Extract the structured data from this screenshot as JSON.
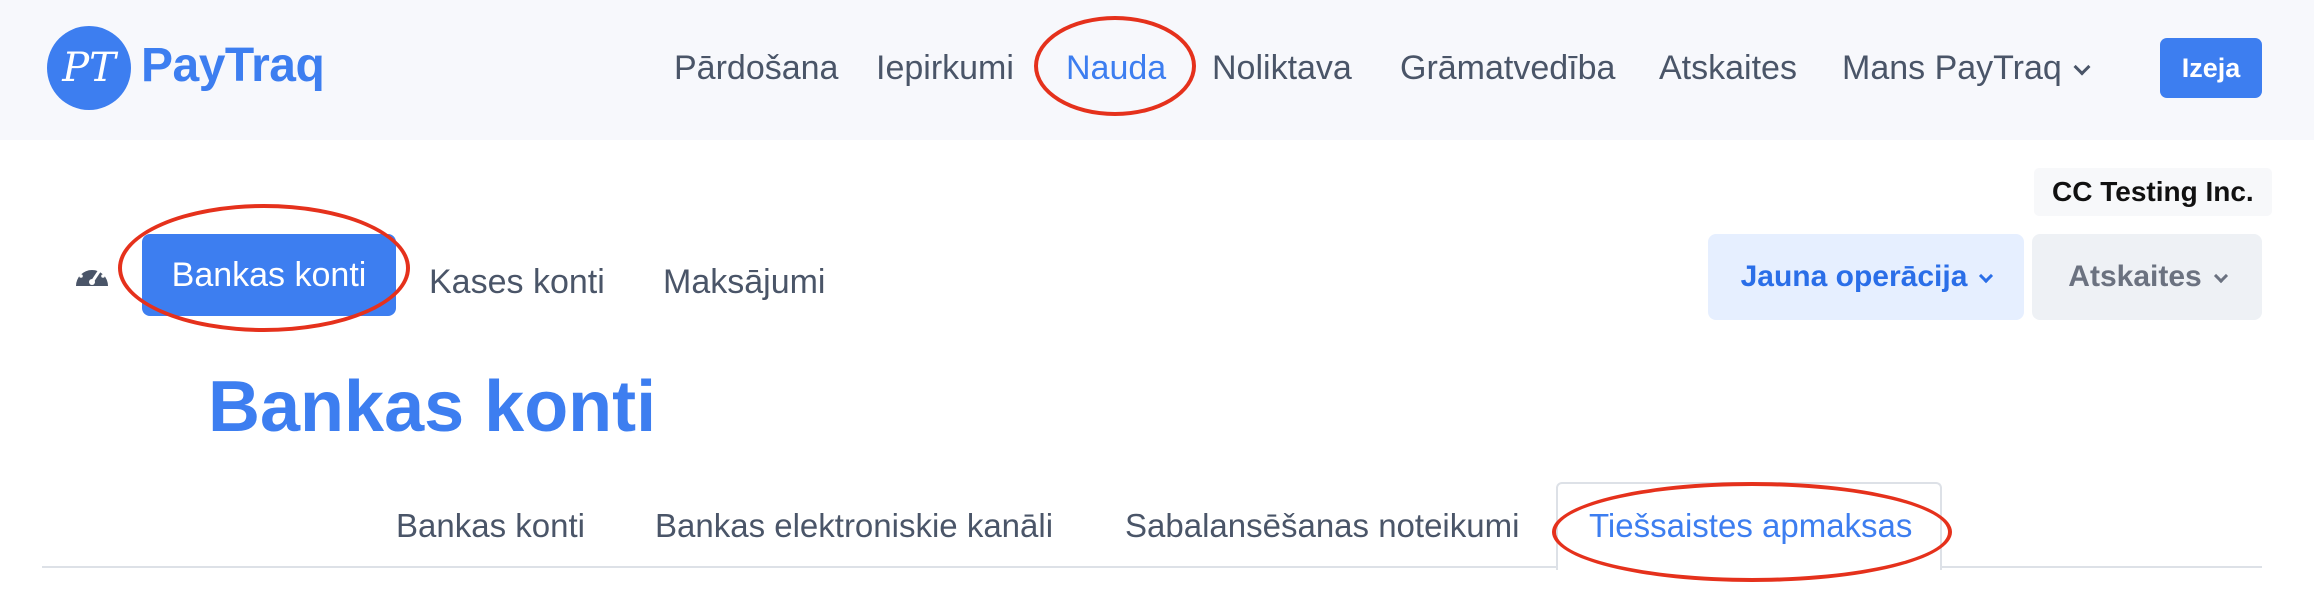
{
  "app": {
    "logo_initials": "PT",
    "logo_text": "PayTraq"
  },
  "topnav": {
    "items": [
      {
        "label": "Pārdošana"
      },
      {
        "label": "Iepirkumi"
      },
      {
        "label": "Nauda",
        "active": true
      },
      {
        "label": "Noliktava"
      },
      {
        "label": "Grāmatvedība"
      },
      {
        "label": "Atskaites"
      },
      {
        "label": "Mans PayTraq",
        "dropdown": true
      }
    ],
    "exit_label": "Izeja"
  },
  "company": "CC Testing Inc.",
  "subnav": {
    "items": [
      {
        "label": "Bankas konti",
        "active": true
      },
      {
        "label": "Kases konti"
      },
      {
        "label": "Maksājumi"
      }
    ],
    "new_operation_label": "Jauna operācija",
    "reports_label": "Atskaites"
  },
  "page": {
    "title": "Bankas konti",
    "tabs": [
      {
        "label": "Bankas konti"
      },
      {
        "label": "Bankas elektroniskie kanāli"
      },
      {
        "label": "Sabalansēšanas noteikumi"
      },
      {
        "label": "Tiešsaistes apmaksas",
        "active": true
      }
    ]
  },
  "colors": {
    "accent": "#3d7ef0",
    "annotation": "#e5311c",
    "topbar_bg": "#f7f8fc"
  },
  "icons": {
    "dashboard": "gauge-icon",
    "dropdown": "chevron-down-icon"
  }
}
